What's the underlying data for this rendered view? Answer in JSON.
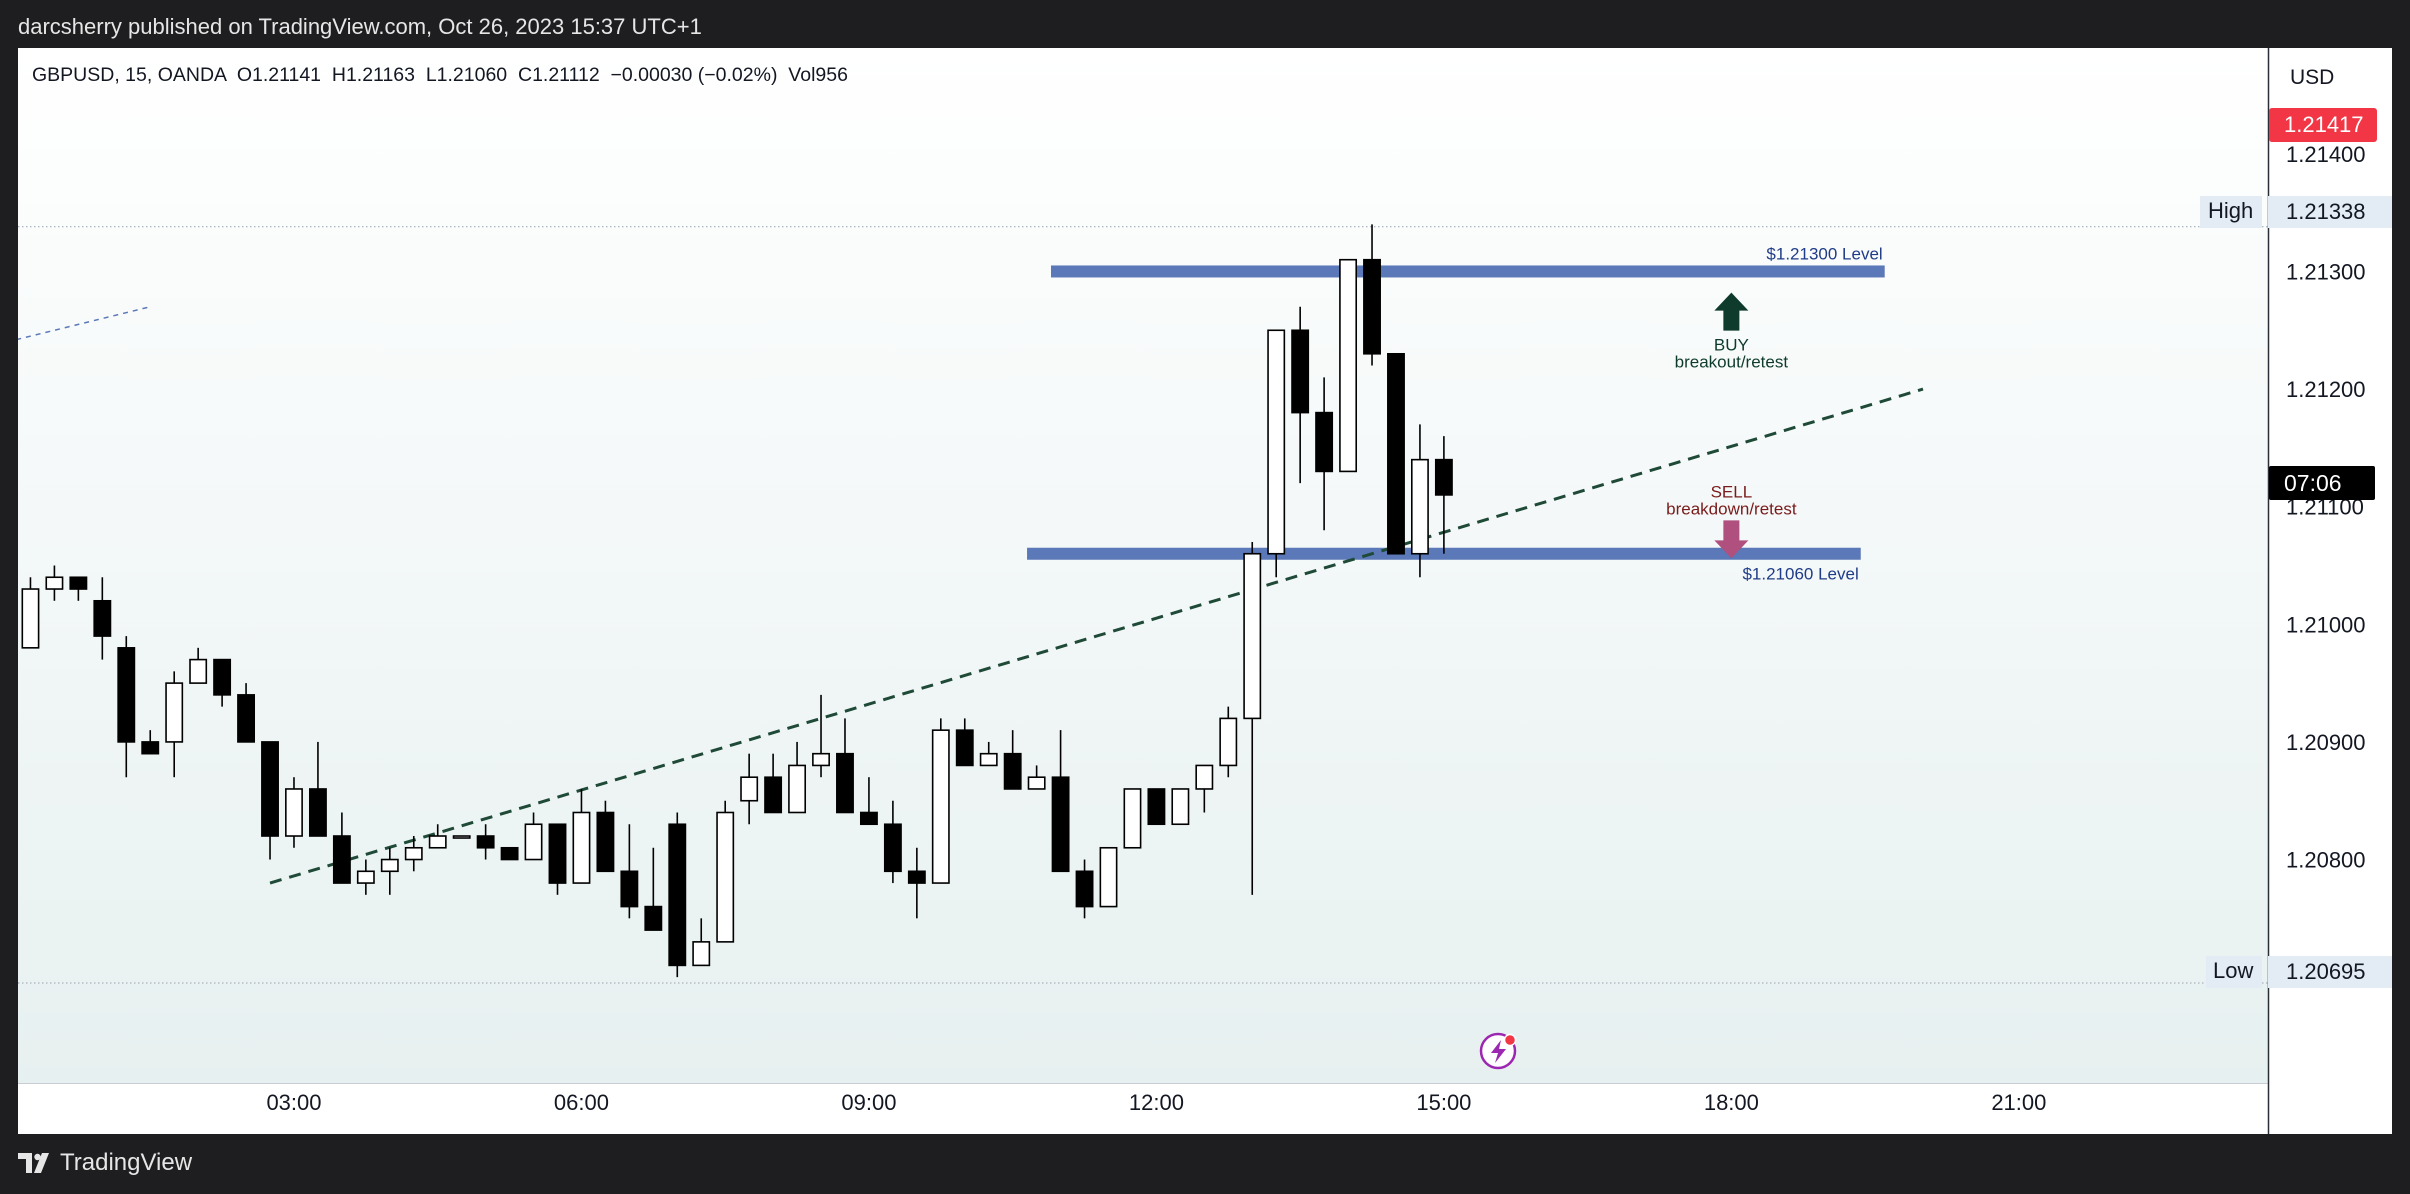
{
  "header": {
    "publisher_line": "darcsherry published on TradingView.com, Oct 26, 2023 15:37 UTC+1"
  },
  "footer": {
    "brand": "TradingView"
  },
  "legend": {
    "text": "GBPUSD, 15, OANDA  O1.21141  H1.21163  L1.21060  C1.21112  −0.00030 (−0.02%)  Vol956"
  },
  "price_scale": {
    "currency": "USD",
    "current_price": "1.21417",
    "countdown": "07:06",
    "high_label": "High",
    "high_value": "1.21338",
    "low_label": "Low",
    "low_value": "1.20695"
  },
  "colors": {
    "bull": "#ffffff",
    "bear": "#000000",
    "level": "#5b78b8",
    "trend": "#1f4a38",
    "buy": "#0e3b2c",
    "sell": "#b0507f",
    "price_tag": "#f23645",
    "background_top": "#ffffff",
    "background_bottom": "#e7f0f0"
  },
  "icons": {
    "lightning": "lightning-icon",
    "logo": "tradingview-logo-icon"
  },
  "chart_data": {
    "type": "candlestick",
    "symbol": "GBPUSD",
    "interval": "15",
    "ylim": [
      1.2061,
      1.2149
    ],
    "xlim": [
      0.12,
      23.6
    ],
    "yticks": [
      {
        "value": 1.214,
        "label": "1.21400"
      },
      {
        "value": 1.213,
        "label": "1.21300"
      },
      {
        "value": 1.212,
        "label": "1.21200"
      },
      {
        "value": 1.211,
        "label": "1.21100"
      },
      {
        "value": 1.21,
        "label": "1.21000"
      },
      {
        "value": 1.209,
        "label": "1.20900"
      },
      {
        "value": 1.208,
        "label": "1.20800"
      }
    ],
    "xticks": [
      {
        "value": 3,
        "label": "03:00"
      },
      {
        "value": 6,
        "label": "06:00"
      },
      {
        "value": 9,
        "label": "09:00"
      },
      {
        "value": 12,
        "label": "12:00"
      },
      {
        "value": 15,
        "label": "15:00"
      },
      {
        "value": 18,
        "label": "18:00"
      },
      {
        "value": 21,
        "label": "21:00"
      }
    ],
    "candles": [
      {
        "t": 0.0,
        "o": 1.2097,
        "h": 1.2099,
        "l": 1.2094,
        "c": 1.2099
      },
      {
        "t": 0.25,
        "o": 1.2098,
        "h": 1.2104,
        "l": 1.2098,
        "c": 1.2103
      },
      {
        "t": 0.5,
        "o": 1.2103,
        "h": 1.2105,
        "l": 1.2102,
        "c": 1.2104
      },
      {
        "t": 0.75,
        "o": 1.2104,
        "h": 1.2104,
        "l": 1.2102,
        "c": 1.2103
      },
      {
        "t": 1.0,
        "o": 1.2102,
        "h": 1.2104,
        "l": 1.2097,
        "c": 1.2099
      },
      {
        "t": 1.25,
        "o": 1.2098,
        "h": 1.2099,
        "l": 1.2087,
        "c": 1.209
      },
      {
        "t": 1.5,
        "o": 1.209,
        "h": 1.2091,
        "l": 1.2089,
        "c": 1.2089
      },
      {
        "t": 1.75,
        "o": 1.209,
        "h": 1.2096,
        "l": 1.2087,
        "c": 1.2095
      },
      {
        "t": 2.0,
        "o": 1.2095,
        "h": 1.2098,
        "l": 1.2095,
        "c": 1.2097
      },
      {
        "t": 2.25,
        "o": 1.2097,
        "h": 1.2097,
        "l": 1.2093,
        "c": 1.2094
      },
      {
        "t": 2.5,
        "o": 1.2094,
        "h": 1.2095,
        "l": 1.209,
        "c": 1.209
      },
      {
        "t": 2.75,
        "o": 1.209,
        "h": 1.209,
        "l": 1.208,
        "c": 1.2082
      },
      {
        "t": 3.0,
        "o": 1.2082,
        "h": 1.2087,
        "l": 1.2081,
        "c": 1.2086
      },
      {
        "t": 3.25,
        "o": 1.2086,
        "h": 1.209,
        "l": 1.2082,
        "c": 1.2082
      },
      {
        "t": 3.5,
        "o": 1.2082,
        "h": 1.2084,
        "l": 1.2078,
        "c": 1.2078
      },
      {
        "t": 3.75,
        "o": 1.2078,
        "h": 1.208,
        "l": 1.2077,
        "c": 1.2079
      },
      {
        "t": 4.0,
        "o": 1.2079,
        "h": 1.2081,
        "l": 1.2077,
        "c": 1.208
      },
      {
        "t": 4.25,
        "o": 1.208,
        "h": 1.2082,
        "l": 1.2079,
        "c": 1.2081
      },
      {
        "t": 4.5,
        "o": 1.2081,
        "h": 1.2083,
        "l": 1.2081,
        "c": 1.2082
      },
      {
        "t": 4.75,
        "o": 1.2082,
        "h": 1.2082,
        "l": 1.2082,
        "c": 1.2082
      },
      {
        "t": 5.0,
        "o": 1.2082,
        "h": 1.2083,
        "l": 1.208,
        "c": 1.2081
      },
      {
        "t": 5.25,
        "o": 1.2081,
        "h": 1.2081,
        "l": 1.208,
        "c": 1.208
      },
      {
        "t": 5.5,
        "o": 1.208,
        "h": 1.2084,
        "l": 1.208,
        "c": 1.2083
      },
      {
        "t": 5.75,
        "o": 1.2083,
        "h": 1.2083,
        "l": 1.2077,
        "c": 1.2078
      },
      {
        "t": 6.0,
        "o": 1.2078,
        "h": 1.2086,
        "l": 1.2078,
        "c": 1.2084
      },
      {
        "t": 6.25,
        "o": 1.2084,
        "h": 1.2085,
        "l": 1.2079,
        "c": 1.2079
      },
      {
        "t": 6.5,
        "o": 1.2079,
        "h": 1.2083,
        "l": 1.2075,
        "c": 1.2076
      },
      {
        "t": 6.75,
        "o": 1.2076,
        "h": 1.2081,
        "l": 1.2074,
        "c": 1.2074
      },
      {
        "t": 7.0,
        "o": 1.2083,
        "h": 1.2084,
        "l": 1.207,
        "c": 1.2071
      },
      {
        "t": 7.25,
        "o": 1.2071,
        "h": 1.2075,
        "l": 1.2071,
        "c": 1.2073
      },
      {
        "t": 7.5,
        "o": 1.2073,
        "h": 1.2085,
        "l": 1.2073,
        "c": 1.2084
      },
      {
        "t": 7.75,
        "o": 1.2085,
        "h": 1.2089,
        "l": 1.2083,
        "c": 1.2087
      },
      {
        "t": 8.0,
        "o": 1.2087,
        "h": 1.2089,
        "l": 1.2084,
        "c": 1.2084
      },
      {
        "t": 8.25,
        "o": 1.2084,
        "h": 1.209,
        "l": 1.2084,
        "c": 1.2088
      },
      {
        "t": 8.5,
        "o": 1.2088,
        "h": 1.2094,
        "l": 1.2087,
        "c": 1.2089
      },
      {
        "t": 8.75,
        "o": 1.2089,
        "h": 1.2092,
        "l": 1.2084,
        "c": 1.2084
      },
      {
        "t": 9.0,
        "o": 1.2084,
        "h": 1.2087,
        "l": 1.2083,
        "c": 1.2083
      },
      {
        "t": 9.25,
        "o": 1.2083,
        "h": 1.2085,
        "l": 1.2078,
        "c": 1.2079
      },
      {
        "t": 9.5,
        "o": 1.2079,
        "h": 1.2081,
        "l": 1.2075,
        "c": 1.2078
      },
      {
        "t": 9.75,
        "o": 1.2078,
        "h": 1.2092,
        "l": 1.2078,
        "c": 1.2091
      },
      {
        "t": 10.0,
        "o": 1.2091,
        "h": 1.2092,
        "l": 1.2088,
        "c": 1.2088
      },
      {
        "t": 10.25,
        "o": 1.2088,
        "h": 1.209,
        "l": 1.2088,
        "c": 1.2089
      },
      {
        "t": 10.5,
        "o": 1.2089,
        "h": 1.2091,
        "l": 1.2086,
        "c": 1.2086
      },
      {
        "t": 10.75,
        "o": 1.2086,
        "h": 1.2088,
        "l": 1.2086,
        "c": 1.2087
      },
      {
        "t": 11.0,
        "o": 1.2087,
        "h": 1.2091,
        "l": 1.2079,
        "c": 1.2079
      },
      {
        "t": 11.25,
        "o": 1.2079,
        "h": 1.208,
        "l": 1.2075,
        "c": 1.2076
      },
      {
        "t": 11.5,
        "o": 1.2076,
        "h": 1.2081,
        "l": 1.2076,
        "c": 1.2081
      },
      {
        "t": 11.75,
        "o": 1.2081,
        "h": 1.2086,
        "l": 1.2081,
        "c": 1.2086
      },
      {
        "t": 12.0,
        "o": 1.2086,
        "h": 1.2086,
        "l": 1.2083,
        "c": 1.2083
      },
      {
        "t": 12.25,
        "o": 1.2083,
        "h": 1.2086,
        "l": 1.2083,
        "c": 1.2086
      },
      {
        "t": 12.5,
        "o": 1.2086,
        "h": 1.2088,
        "l": 1.2084,
        "c": 1.2088
      },
      {
        "t": 12.75,
        "o": 1.2088,
        "h": 1.2093,
        "l": 1.2087,
        "c": 1.2092
      },
      {
        "t": 13.0,
        "o": 1.2092,
        "h": 1.2107,
        "l": 1.2077,
        "c": 1.2106
      },
      {
        "t": 13.25,
        "o": 1.2106,
        "h": 1.2125,
        "l": 1.2104,
        "c": 1.2125
      },
      {
        "t": 13.5,
        "o": 1.2125,
        "h": 1.2127,
        "l": 1.2112,
        "c": 1.2118
      },
      {
        "t": 13.75,
        "o": 1.2118,
        "h": 1.2121,
        "l": 1.2108,
        "c": 1.2113
      },
      {
        "t": 14.0,
        "o": 1.2113,
        "h": 1.2131,
        "l": 1.2113,
        "c": 1.2131
      },
      {
        "t": 14.25,
        "o": 1.2131,
        "h": 1.2134,
        "l": 1.2122,
        "c": 1.2123
      },
      {
        "t": 14.5,
        "o": 1.2123,
        "h": 1.2123,
        "l": 1.2106,
        "c": 1.2106
      },
      {
        "t": 14.75,
        "o": 1.2106,
        "h": 1.2117,
        "l": 1.2104,
        "c": 1.2114
      },
      {
        "t": 15.0,
        "o": 1.2114,
        "h": 1.2116,
        "l": 1.2106,
        "c": 1.2111
      }
    ],
    "horizontal_levels": [
      {
        "price": 1.213,
        "label": "$1.21300 Level",
        "t_start": 10.9,
        "t_end": 19.6
      },
      {
        "price": 1.2106,
        "label": "$1.21060 Level",
        "t_start": 10.65,
        "t_end": 19.35
      }
    ],
    "trend_line": {
      "t1": 2.75,
      "p1": 1.2078,
      "t2": 20.0,
      "p2": 1.212
    },
    "short_dashed_line": {
      "t1": 0.0,
      "p1": 1.2124,
      "t2": 1.5,
      "p2": 1.2127
    },
    "high_line": 1.21338,
    "low_line": 1.20695,
    "annotations": [
      {
        "kind": "up-arrow",
        "t": 18.0,
        "price": 1.21265,
        "text1": "BUY",
        "text2": "breakout/retest"
      },
      {
        "kind": "down-arrow",
        "t": 18.0,
        "price": 1.21068,
        "text1": "SELL",
        "text2": "breakdown/retest"
      }
    ]
  }
}
